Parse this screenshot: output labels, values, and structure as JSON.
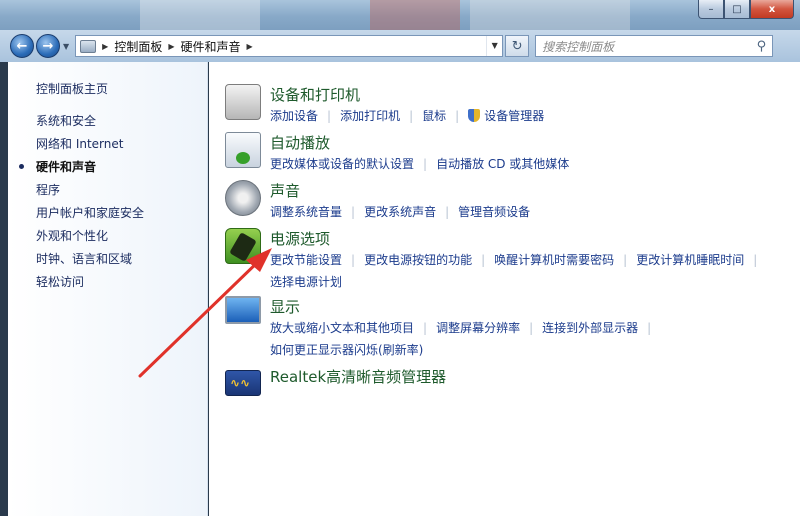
{
  "window": {
    "minimize_label": "–",
    "maximize_label": "□",
    "close_label": "x"
  },
  "nav": {
    "back_glyph": "←",
    "forward_glyph": "→",
    "breadcrumb": [
      "控制面板",
      "硬件和声音"
    ],
    "refresh_glyph": "↻",
    "search_placeholder": "搜索控制面板"
  },
  "sidebar": {
    "home": "控制面板主页",
    "items": [
      {
        "label": "系统和安全"
      },
      {
        "label": "网络和 Internet"
      },
      {
        "label": "硬件和声音",
        "active": true
      },
      {
        "label": "程序"
      },
      {
        "label": "用户帐户和家庭安全"
      },
      {
        "label": "外观和个性化"
      },
      {
        "label": "时钟、语言和区域"
      },
      {
        "label": "轻松访问"
      }
    ]
  },
  "categories": [
    {
      "icon": "printer-icon",
      "title": "设备和打印机",
      "links": [
        "添加设备",
        "添加打印机",
        "鼠标",
        "设备管理器"
      ]
    },
    {
      "icon": "autoplay-icon",
      "title": "自动播放",
      "links": [
        "更改媒体或设备的默认设置",
        "自动播放 CD 或其他媒体"
      ]
    },
    {
      "icon": "speaker-icon",
      "title": "声音",
      "links": [
        "调整系统音量",
        "更改系统声音",
        "管理音频设备"
      ]
    },
    {
      "icon": "battery-icon",
      "title": "电源选项",
      "links": [
        "更改节能设置",
        "更改电源按钮的功能",
        "唤醒计算机时需要密码",
        "更改计算机睡眠时间",
        "选择电源计划"
      ]
    },
    {
      "icon": "monitor-icon",
      "title": "显示",
      "links": [
        "放大或缩小文本和其他项目",
        "调整屏幕分辨率",
        "连接到外部显示器",
        "如何更正显示器闪烁(刷新率)"
      ]
    },
    {
      "icon": "realtek-icon",
      "title": "Realtek高清晰音频管理器",
      "links": []
    }
  ],
  "colors": {
    "category_title": "#1e5a2c",
    "link": "#1b3b8c",
    "annotation_arrow": "#e0322a"
  }
}
